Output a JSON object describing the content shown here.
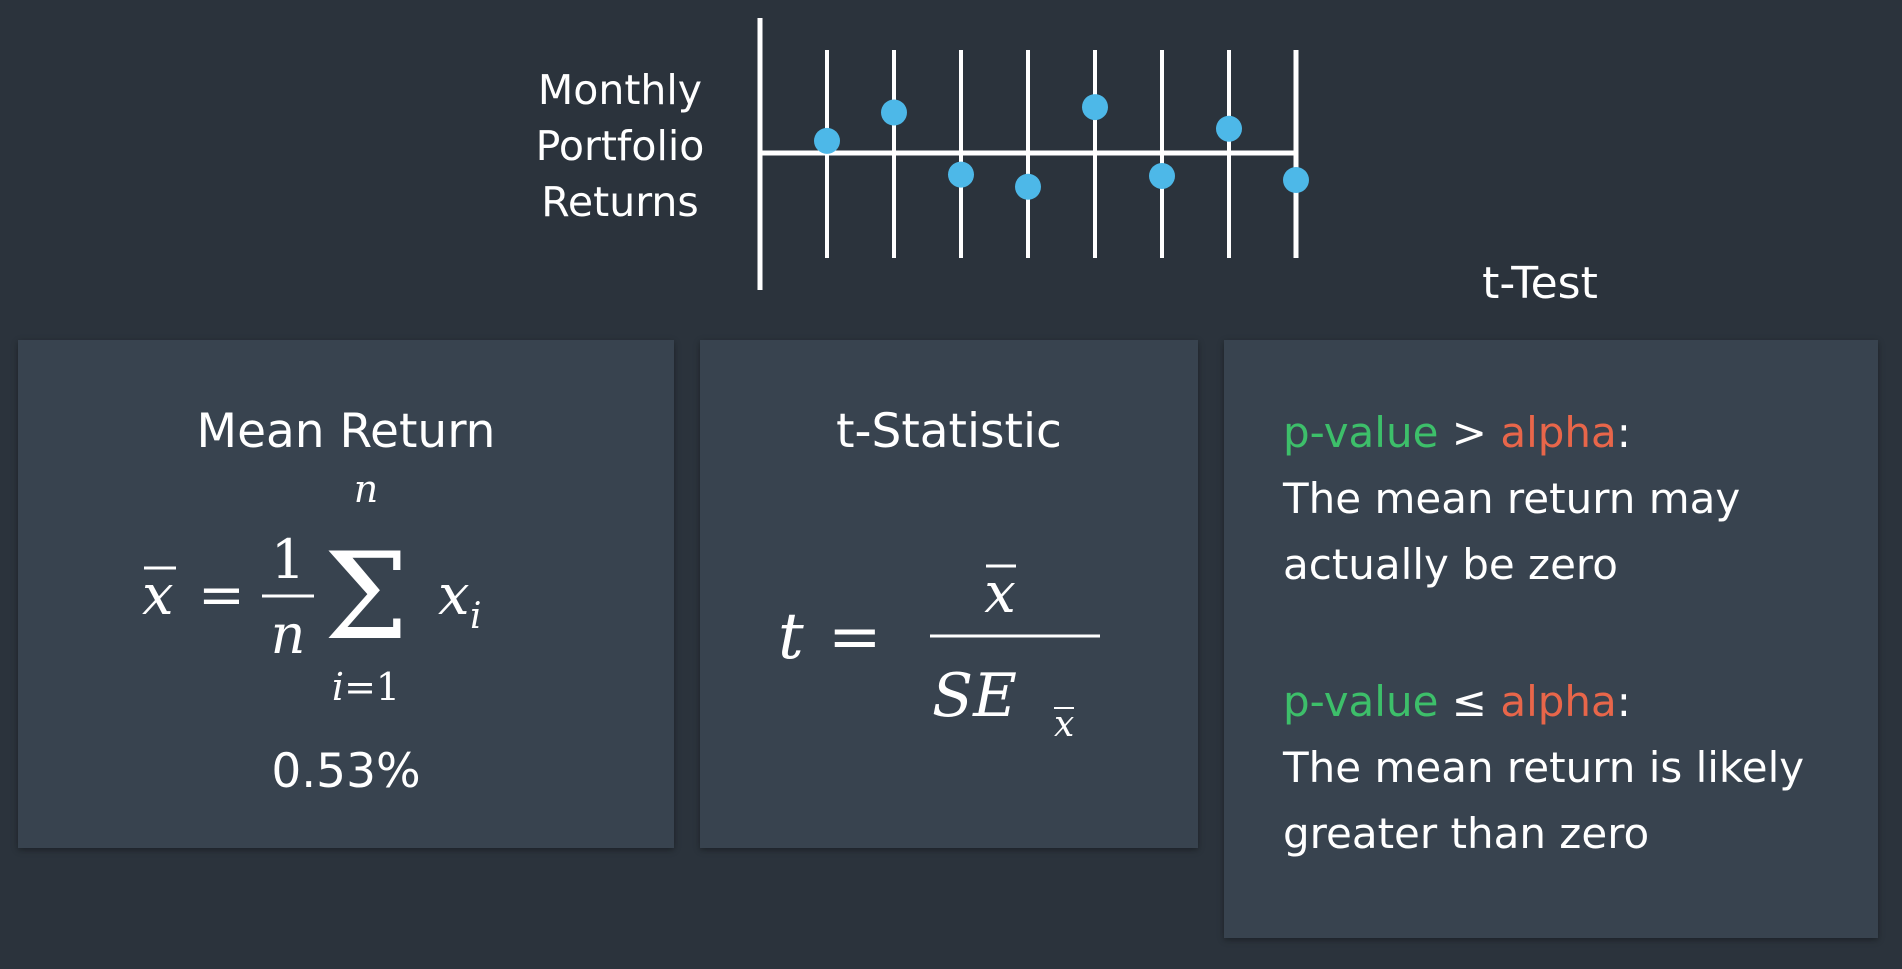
{
  "returns_label": [
    "Monthly",
    "Portfolio",
    "Returns"
  ],
  "returns_points": [
    0.09,
    0.3,
    -0.16,
    -0.25,
    0.34,
    -0.17,
    0.18,
    -0.2
  ],
  "ttest_heading": "t-Test",
  "mean_card": {
    "title": "Mean Return",
    "value": "0.53%"
  },
  "tstat_card": {
    "title": "t-Statistic"
  },
  "ttest_card": {
    "rule1": {
      "p": "p-value",
      "op": " > ",
      "alpha": "alpha",
      "colon": ":",
      "line1": "The mean return may",
      "line2": "actually be zero"
    },
    "rule2": {
      "p": "p-value",
      "op": " ≤ ",
      "alpha": "alpha",
      "colon": ":",
      "line1": "The mean return is likely",
      "line2": "greater than zero"
    }
  },
  "colors": {
    "background": "#2b333c",
    "card": "#38434f",
    "point": "#4db8e8",
    "p_value": "#3dbf6a",
    "alpha": "#e8664a"
  }
}
